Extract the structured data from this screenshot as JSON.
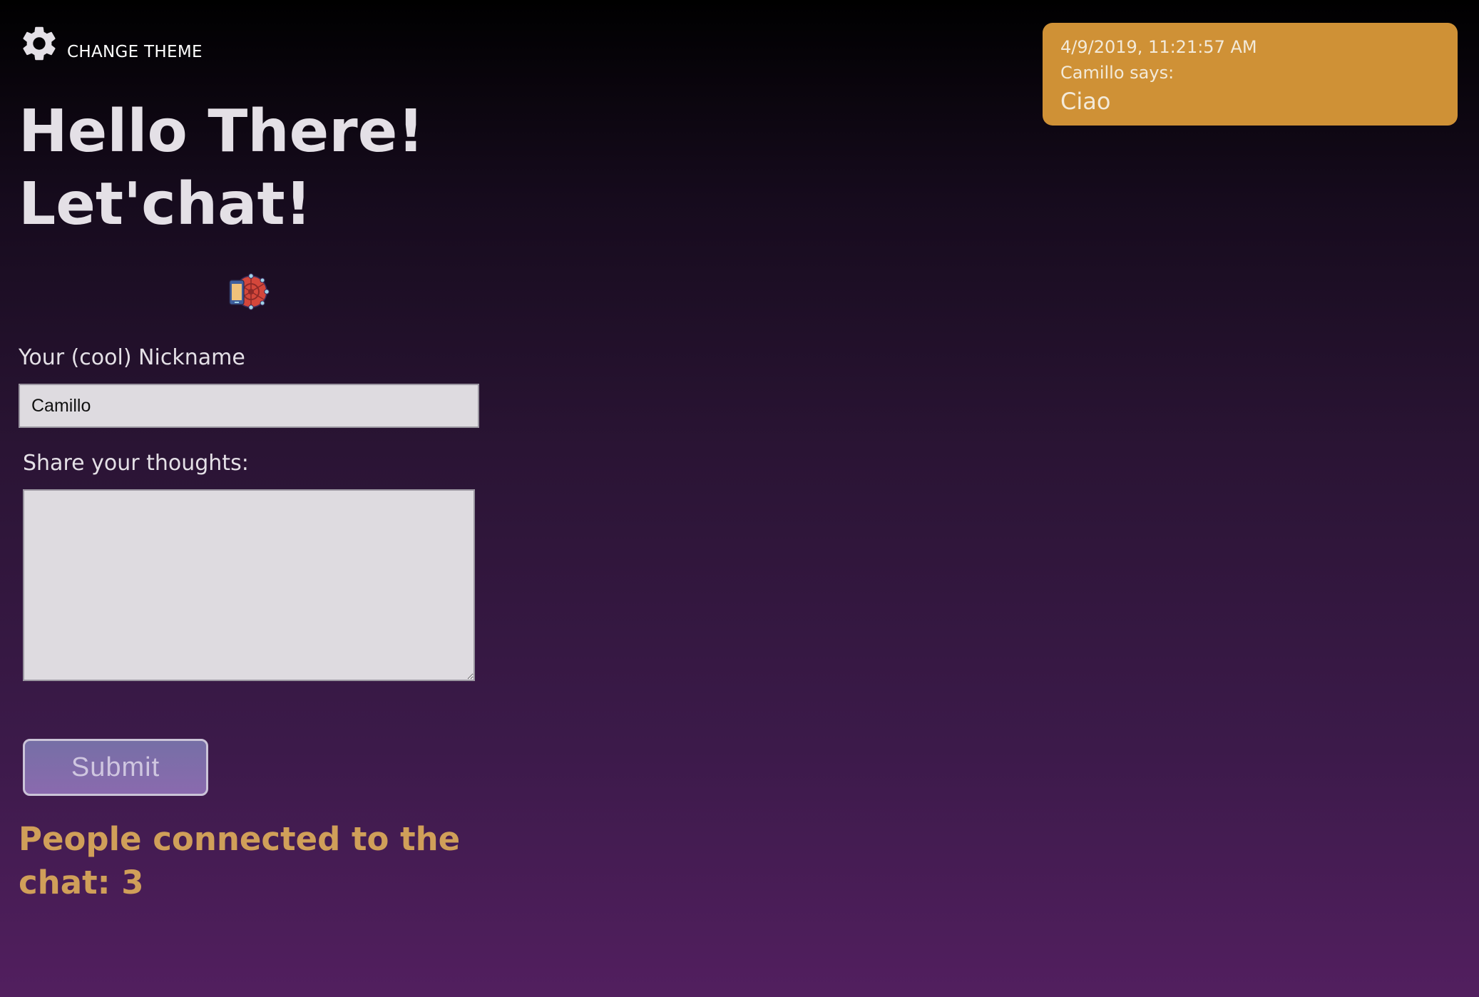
{
  "theme_toggle": {
    "label": "CHANGE THEME",
    "icon": "gear-icon"
  },
  "hero": {
    "line1": "Hello There!",
    "line2": "Let'chat!"
  },
  "logo": {
    "icon": "phone-network-icon"
  },
  "form": {
    "nickname_label": "Your (cool) Nickname",
    "nickname_value": "Camillo",
    "thoughts_label": "Share your thoughts:",
    "thoughts_value": "",
    "submit_label": "Submit"
  },
  "status": {
    "connected_text": "People connected to the chat: 3"
  },
  "messages": [
    {
      "timestamp": "4/9/2019, 11:21:57 AM",
      "author_line": "Camillo says:",
      "text": "Ciao"
    }
  ],
  "colors": {
    "accent": "#d09f59",
    "message_card": "#cf9136",
    "button": "#7c6dab",
    "background_top": "#000000",
    "background_bottom": "#521f5f"
  }
}
